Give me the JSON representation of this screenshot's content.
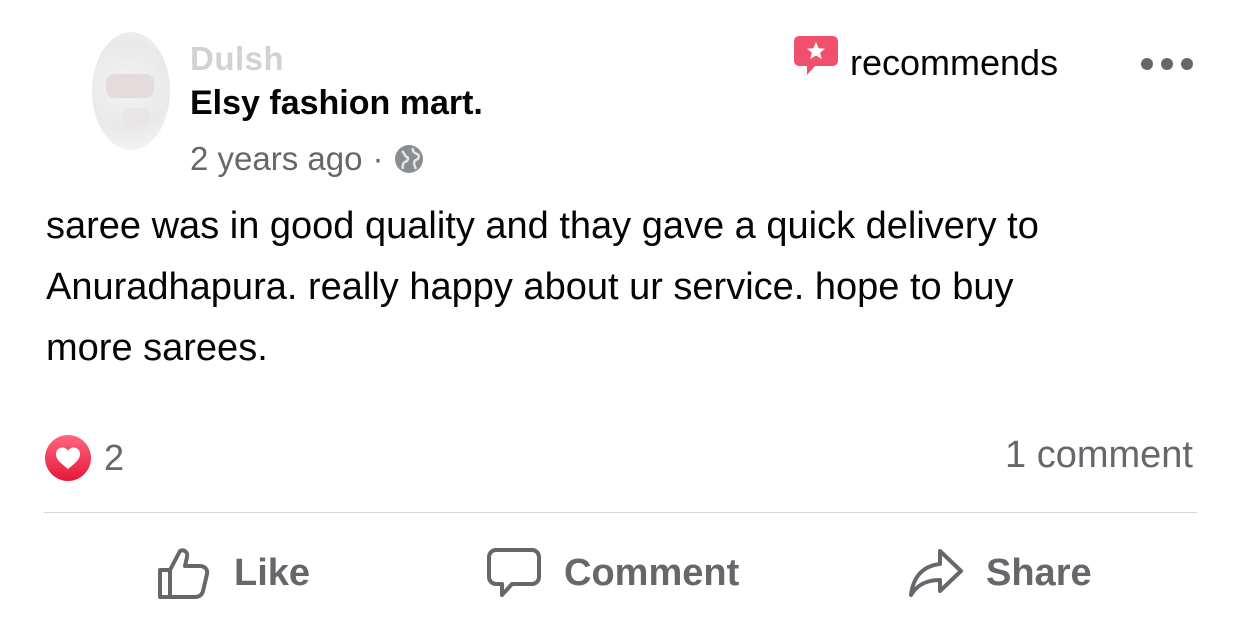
{
  "post": {
    "author": "Dulsh",
    "page_name": "Elsy fashion mart.",
    "recommends_label": "recommends",
    "time_ago": "2 years ago",
    "separator": "·",
    "review_text": "saree was in good quality and thay gave a quick delivery to Anuradhapura. really happy about ur service. hope to buy more sarees.",
    "reaction_count": "2",
    "comment_count": "1 comment"
  },
  "actions": {
    "like": "Like",
    "comment": "Comment",
    "share": "Share"
  },
  "icons": {
    "recommend": "recommend-star-icon",
    "more": "more-options-icon",
    "privacy": "globe-icon",
    "reaction": "love-heart-icon",
    "like": "thumbs-up-icon",
    "comment": "comment-bubble-icon",
    "share": "share-arrow-icon"
  },
  "colors": {
    "recommend_red": "#f0506e",
    "heart_red": "#f33e58",
    "text_primary": "#050505",
    "text_secondary": "#65676b",
    "author_faded": "#d2d2d2"
  }
}
